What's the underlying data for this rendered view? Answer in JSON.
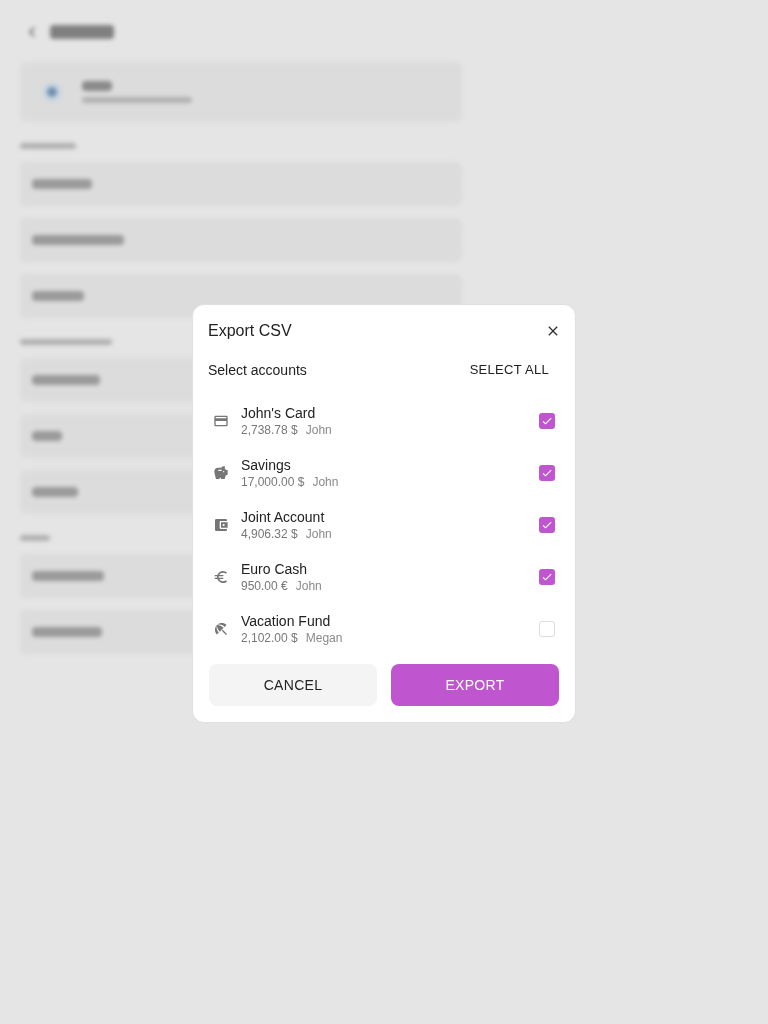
{
  "dialog": {
    "title": "Export CSV",
    "subtitle": "Select accounts",
    "select_all": "SELECT ALL",
    "accounts": [
      {
        "kind": "card",
        "name": "John's Card",
        "amount": "2,738.78 $",
        "owner": "John",
        "checked": true
      },
      {
        "kind": "savings",
        "name": "Savings",
        "amount": "17,000.00 $",
        "owner": "John",
        "checked": true
      },
      {
        "kind": "wallet",
        "name": "Joint Account",
        "amount": "4,906.32 $",
        "owner": "John",
        "checked": true
      },
      {
        "kind": "cash",
        "name": "Euro Cash",
        "amount": "950.00 €",
        "owner": "John",
        "checked": true
      },
      {
        "kind": "vacation",
        "name": "Vacation Fund",
        "amount": "2,102.00 $",
        "owner": "Megan",
        "checked": false
      }
    ],
    "buttons": [
      {
        "label": "CANCEL",
        "kind": "secondary"
      },
      {
        "label": "EXPORT",
        "kind": "primary"
      }
    ]
  }
}
